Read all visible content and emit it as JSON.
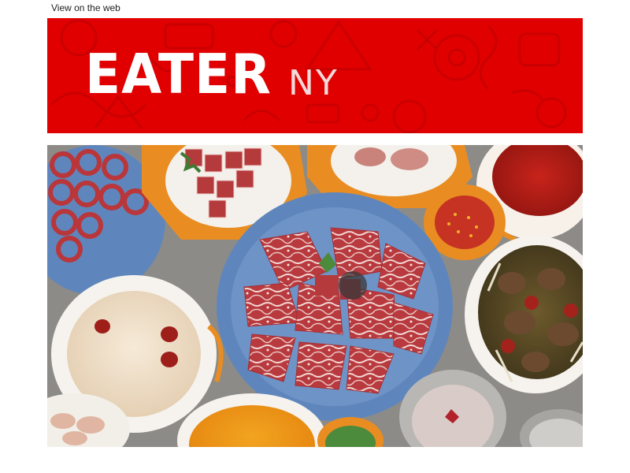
{
  "header": {
    "view_on_web": "View on the web"
  },
  "banner": {
    "logo_text": "EATER",
    "city_text": "NY",
    "background_color": "#e10000"
  },
  "hero": {
    "image_subject": "hot pot spread with marbled beef, broths and mushrooms",
    "icon": "food-photo"
  }
}
